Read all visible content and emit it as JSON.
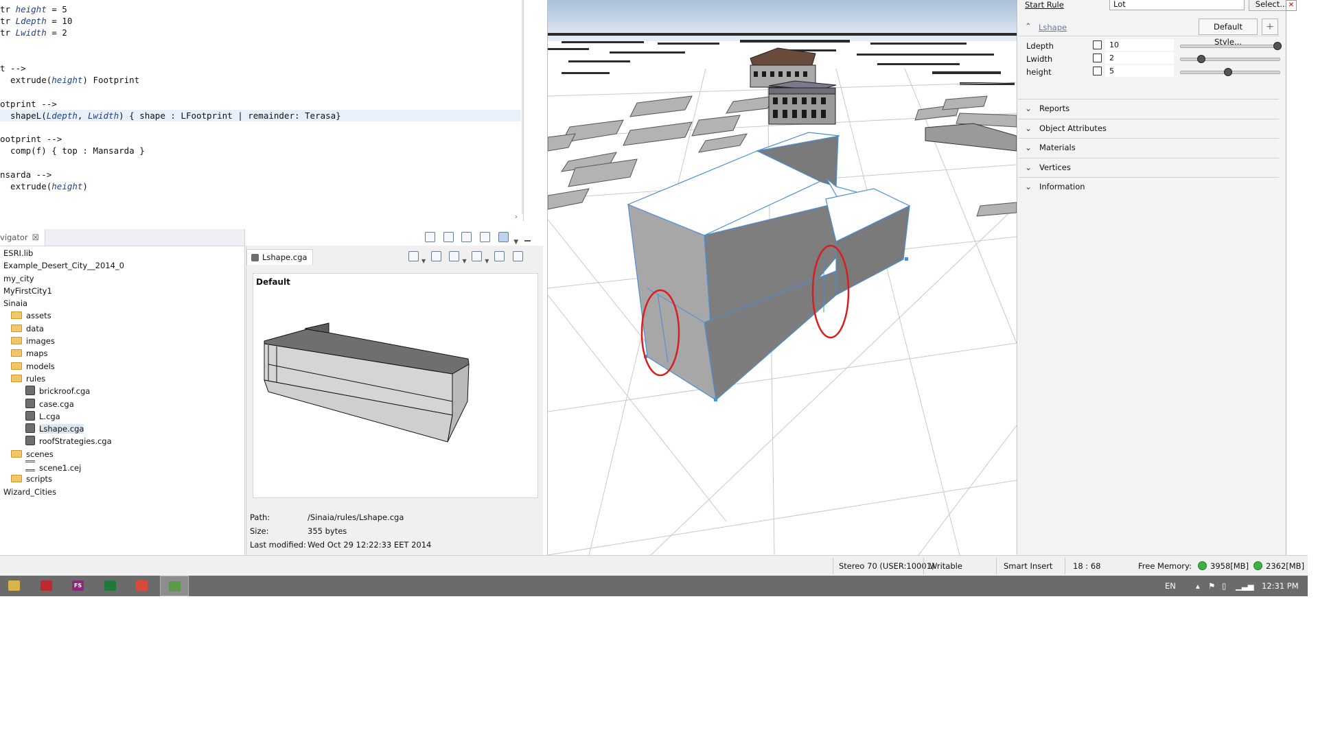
{
  "editor": {
    "lines": [
      {
        "segments": [
          {
            "t": "tr "
          },
          {
            "t": "height",
            "i": true
          },
          {
            "t": " = 5"
          }
        ]
      },
      {
        "segments": [
          {
            "t": "tr "
          },
          {
            "t": "Ldepth",
            "i": true
          },
          {
            "t": " = 10"
          }
        ]
      },
      {
        "segments": [
          {
            "t": "tr "
          },
          {
            "t": "Lwidth",
            "i": true
          },
          {
            "t": " = 2"
          }
        ]
      },
      {
        "segments": []
      },
      {
        "segments": []
      },
      {
        "segments": [
          {
            "t": "t -->"
          }
        ]
      },
      {
        "segments": [
          {
            "t": "  extrude("
          },
          {
            "t": "height",
            "i": true
          },
          {
            "t": ") Footprint"
          }
        ]
      },
      {
        "segments": []
      },
      {
        "segments": [
          {
            "t": "otprint -->"
          }
        ]
      },
      {
        "segments": [
          {
            "t": "  shapeL("
          },
          {
            "t": "Ldepth",
            "i": true
          },
          {
            "t": ", "
          },
          {
            "t": "Lwidth",
            "i": true
          },
          {
            "t": ") { shape : LFootprint | remainder: Terasa}"
          }
        ],
        "highlight": true
      },
      {
        "segments": []
      },
      {
        "segments": [
          {
            "t": "ootprint -->"
          }
        ]
      },
      {
        "segments": [
          {
            "t": "  comp(f) { top : Mansarda }"
          }
        ]
      },
      {
        "segments": []
      },
      {
        "segments": [
          {
            "t": "nsarda -->"
          }
        ]
      },
      {
        "segments": [
          {
            "t": "  extrude("
          },
          {
            "t": "height",
            "i": true
          },
          {
            "t": ")"
          }
        ]
      }
    ]
  },
  "navigator": {
    "tab_label": "vigator",
    "close_glyph": "☒",
    "items": [
      {
        "label": "ESRI.lib",
        "indent": 0,
        "icon": "none"
      },
      {
        "label": "Example_Desert_City__2014_0",
        "indent": 0,
        "icon": "none"
      },
      {
        "label": "my_city",
        "indent": 0,
        "icon": "none"
      },
      {
        "label": "MyFirstCity1",
        "indent": 0,
        "icon": "none"
      },
      {
        "label": "Sinaia",
        "indent": 0,
        "icon": "none"
      },
      {
        "label": "assets",
        "indent": 1,
        "icon": "folder"
      },
      {
        "label": "data",
        "indent": 1,
        "icon": "folder"
      },
      {
        "label": "images",
        "indent": 1,
        "icon": "folder"
      },
      {
        "label": "maps",
        "indent": 1,
        "icon": "folder"
      },
      {
        "label": "models",
        "indent": 1,
        "icon": "folder"
      },
      {
        "label": "rules",
        "indent": 1,
        "icon": "folder"
      },
      {
        "label": "brickroof.cga",
        "indent": 2,
        "icon": "file"
      },
      {
        "label": "case.cga",
        "indent": 2,
        "icon": "file"
      },
      {
        "label": "L.cga",
        "indent": 2,
        "icon": "file"
      },
      {
        "label": "Lshape.cga",
        "indent": 2,
        "icon": "file",
        "selected": true
      },
      {
        "label": "roofStrategies.cga",
        "indent": 2,
        "icon": "file"
      },
      {
        "label": "scenes",
        "indent": 1,
        "icon": "folder"
      },
      {
        "label": "scene1.cej",
        "indent": 2,
        "icon": "scene"
      },
      {
        "label": "scripts",
        "indent": 1,
        "icon": "folder"
      },
      {
        "label": "Wizard_Cities",
        "indent": 0,
        "icon": "none"
      }
    ]
  },
  "preview": {
    "tab_label": "Lshape.cga",
    "canvas_label": "Default",
    "path_key": "Path:",
    "path_value": "/Sinaia/rules/Lshape.cga",
    "size_key": "Size:",
    "size_value": "355 bytes",
    "modified_key": "Last modified:",
    "modified_value": "Wed Oct 29 12:22:33 EET 2014"
  },
  "inspector": {
    "start_rule_label": "Start Rule",
    "start_rule_value": "Lot",
    "select_button": "Select...",
    "rule_name": "Lshape",
    "style_button": "Default Style...",
    "add_button": "+",
    "attributes": [
      {
        "name": "Ldepth",
        "value": "10",
        "slider": 0.97
      },
      {
        "name": "Lwidth",
        "value": "2",
        "slider": 0.2
      },
      {
        "name": "height",
        "value": "5",
        "slider": 0.47
      }
    ],
    "sections": [
      "Reports",
      "Object Attributes",
      "Materials",
      "Vertices",
      "Information"
    ]
  },
  "status": {
    "stereo": "Stereo 70 (USER:10001)",
    "writable": "Writable",
    "insert_mode": "Smart Insert",
    "position": "18 : 68",
    "memory_label": "Free Memory:",
    "memory_free": "3958[MB]",
    "memory_total": "2362[MB]"
  },
  "taskbar": {
    "apps": [
      {
        "name": "file-explorer",
        "label": "",
        "color": "#d9b44a"
      },
      {
        "name": "pdf-reader",
        "label": "",
        "color": "#c0282d"
      },
      {
        "name": "fs-app",
        "label": "FS",
        "color": "#8b2a7a"
      },
      {
        "name": "spreadsheet",
        "label": "",
        "color": "#1f7a3a"
      },
      {
        "name": "browser",
        "label": "",
        "color": "#d94a3a"
      },
      {
        "name": "cityengine",
        "label": "",
        "color": "#5a9a4a",
        "active": true
      }
    ],
    "lang": "EN",
    "clock": "12:31 PM"
  },
  "colors": {
    "selection_outline": "#4a8fd6",
    "annotation_circle": "#d81e1e",
    "taskbar_bg": "#6b6b6b"
  }
}
